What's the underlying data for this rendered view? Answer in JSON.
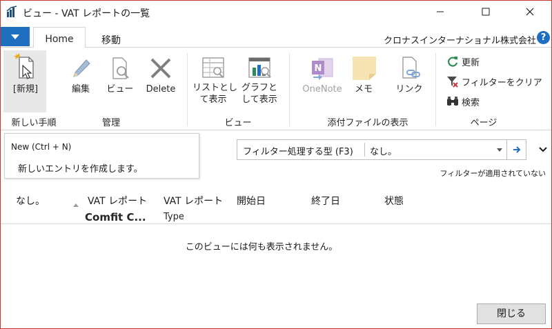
{
  "window": {
    "title": "ビュー - VAT レポートの一覧"
  },
  "ribbon_tabs": {
    "home": "Home",
    "move": "移動"
  },
  "company": "クロナスインターナショナル株式会社",
  "help_label": "?",
  "ribbon": {
    "new": {
      "label": "[新規]",
      "icon": "new-document-icon"
    },
    "edit": {
      "label": "編集",
      "icon": "pencil-icon"
    },
    "view": {
      "label": "ビュー",
      "icon": "view-document-icon"
    },
    "delete": {
      "label": "Delete",
      "icon": "delete-x-icon"
    },
    "show_as_list": {
      "label_line1": "リストとし",
      "label_line2": "て表示",
      "icon": "list-view-icon"
    },
    "show_as_chart": {
      "label_line1": "グラフと",
      "label_line2": "して表示",
      "icon": "chart-view-icon"
    },
    "onenote": {
      "label": "OneNote",
      "icon": "onenote-icon"
    },
    "note": {
      "label": "メモ",
      "icon": "note-icon"
    },
    "link": {
      "label": "リンク",
      "icon": "link-icon"
    },
    "refresh": {
      "label": "更新",
      "icon": "refresh-icon"
    },
    "clear_filter": {
      "label": "フィルターをクリア",
      "icon": "clear-filter-icon"
    },
    "find": {
      "label": "検索",
      "icon": "binoculars-icon"
    }
  },
  "ribbon_groups": {
    "new_group": "新しい手順",
    "manage": "管理",
    "view": "ビュー",
    "attachments": "添付ファイルの表示",
    "page": "ページ"
  },
  "tooltip": {
    "title": "New (Ctrl + N)",
    "body": "新しいエントリを作成します。"
  },
  "filter": {
    "type_label": "フィルター処理する型 (F3)",
    "value": "なし。",
    "status": "フィルターが適用されていない"
  },
  "columns": {
    "none": "なし。",
    "vat_report_line1": "VAT レポート",
    "vat_report_line2": "Comfit C...",
    "vat_report_type_line1": "VAT レポート",
    "vat_report_type_line2": "Type",
    "start_date": "開始日",
    "end_date": "終了日",
    "status": "状態"
  },
  "empty_message": "このビューには何も表示されません。",
  "close_button": "閉じる",
  "colors": {
    "accent": "#1e6fc0",
    "onenote": "#b08bc9",
    "note": "#f6e4b5",
    "border": "#d4d4d4",
    "window_border": "#c0392b"
  }
}
